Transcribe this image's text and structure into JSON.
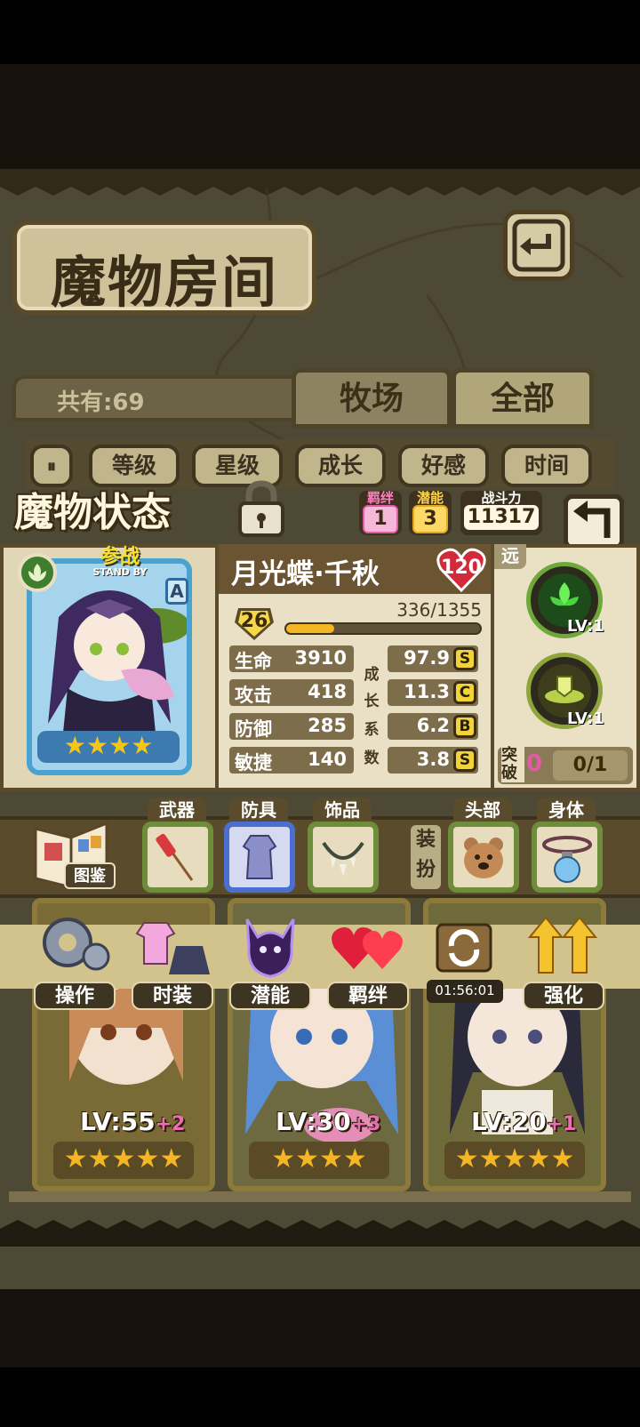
{
  "room": {
    "title": "魔物房间",
    "count_label": "共有:69",
    "tabs": [
      "牧场",
      "全部"
    ]
  },
  "sort": {
    "buttons": [
      "等级",
      "星级",
      "成长",
      "好感",
      "时间"
    ]
  },
  "status": {
    "title": "魔物状态",
    "bond_label": "羁绊",
    "bond_value": "1",
    "potential_label": "潜能",
    "potential_value": "3",
    "power_label": "战斗力",
    "power_value": "11317"
  },
  "monster": {
    "standby_label": "参战",
    "standby_sub": "STAND BY",
    "rank": "A",
    "name": "月光蝶·千秋",
    "affection": "120",
    "level": "26",
    "xp": "336/1355",
    "xp_fraction": 0.248,
    "stars": 4,
    "stats": [
      {
        "label": "生命",
        "value": "3910"
      },
      {
        "label": "攻击",
        "value": "418"
      },
      {
        "label": "防御",
        "value": "285"
      },
      {
        "label": "敏捷",
        "value": "140"
      }
    ],
    "growth_label_chars": [
      "成",
      "长",
      "系",
      "数"
    ],
    "growth": [
      {
        "value": "97.9",
        "grade": "S"
      },
      {
        "value": "11.3",
        "grade": "C"
      },
      {
        "value": "6.2",
        "grade": "B"
      },
      {
        "value": "3.8",
        "grade": "S"
      }
    ]
  },
  "skills": {
    "range_tag": "远",
    "items": [
      {
        "icon": "green-flower-skill-icon",
        "level": "LV:1"
      },
      {
        "icon": "shield-skill-icon",
        "level": "LV:1"
      }
    ],
    "breakthrough_label": "突破",
    "breakthrough_value": "0",
    "breakthrough_progress": "0/1"
  },
  "equipment": {
    "book_label": "图鉴",
    "slots": [
      {
        "label": "武器",
        "icon": "firework-rocket-icon"
      },
      {
        "label": "防具",
        "icon": "dress-icon"
      },
      {
        "label": "饰品",
        "icon": "fang-necklace-icon"
      }
    ],
    "dress_label": "装扮",
    "dress_slots": [
      {
        "label": "头部",
        "icon": "bear-head-icon"
      },
      {
        "label": "身体",
        "icon": "potion-collar-icon"
      }
    ]
  },
  "menu": {
    "buttons": [
      {
        "label": "操作",
        "icon": "gear-icon"
      },
      {
        "label": "时装",
        "icon": "outfit-icon"
      },
      {
        "label": "潜能",
        "icon": "demon-silhouette-icon"
      },
      {
        "label": "羁绊",
        "icon": "red-hearts-icon"
      },
      {
        "label": "",
        "icon": "refresh-chest-icon"
      },
      {
        "label": "强化",
        "icon": "up-arrows-icon"
      }
    ],
    "timer": "01:56:01"
  },
  "roster": [
    {
      "level": "LV:55",
      "plus": "+2",
      "stars": 5
    },
    {
      "level": "LV:30",
      "plus": "+3",
      "stars": 4
    },
    {
      "level": "LV:20",
      "plus": "+1",
      "stars": 5
    }
  ],
  "colors": {
    "accent_gold": "#f5b625",
    "grade_yellow": "#f2d43a",
    "bond_pink": "#e05ca5",
    "potential_gold": "#e3a81c"
  }
}
